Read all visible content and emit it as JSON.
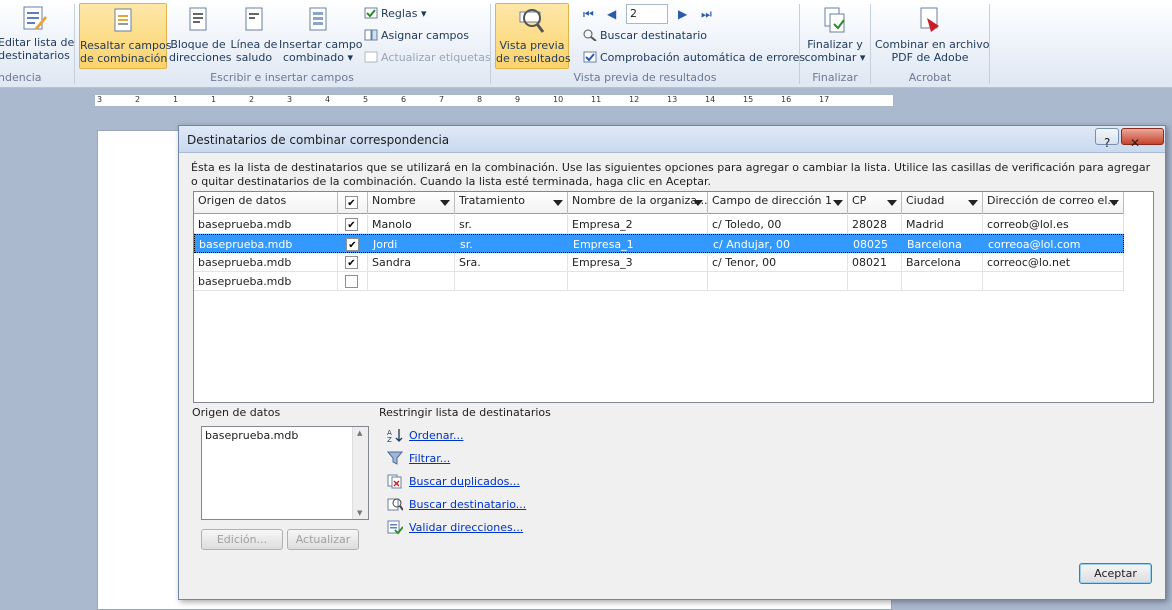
{
  "ribbon": {
    "edit_list": "Editar lista de destinatarios",
    "edit_list_l1": "Editar lista de",
    "edit_list_l2": "destinatarios",
    "group_partial": "ndencia",
    "highlight_l1": "Resaltar campos",
    "highlight_l2": "de combinación",
    "address_block_l1": "Bloque de",
    "address_block_l2": "direcciones",
    "greeting_l1": "Línea de",
    "greeting_l2": "saludo",
    "insert_field_l1": "Insertar campo",
    "insert_field_l2": "combinado",
    "rules": "Reglas",
    "match_fields": "Asignar campos",
    "update_labels": "Actualizar etiquetas",
    "group_write": "Escribir e insertar campos",
    "preview_l1": "Vista previa",
    "preview_l2": "de resultados",
    "record_number": "2",
    "find_recipient": "Buscar destinatario",
    "auto_check": "Comprobación automática de errores",
    "group_preview": "Vista previa de resultados",
    "finish_l1": "Finalizar y",
    "finish_l2": "combinar",
    "group_finish": "Finalizar",
    "pdf_l1": "Combinar en archivo",
    "pdf_l2": "PDF de Adobe",
    "group_acrobat": "Acrobat"
  },
  "ruler": {
    "ticks": [
      "3",
      "2",
      "1",
      "1",
      "2",
      "3",
      "4",
      "5",
      "6",
      "7",
      "8",
      "9",
      "10",
      "11",
      "12",
      "13",
      "14",
      "15",
      "16",
      "17"
    ]
  },
  "dialog": {
    "title": "Destinatarios de combinar correspondencia",
    "help": "?",
    "close": "✕",
    "intro": "Ésta es la lista de destinatarios que se utilizará en la combinación. Use las siguientes opciones para agregar o cambiar la lista. Utilice las casillas de verificación para agregar o quitar destinatarios de la combinación. Cuando la lista esté terminada, haga clic en Aceptar.",
    "columns": [
      "Origen de datos",
      "",
      "Nombre",
      "Tratamiento",
      "Nombre de la organiza...",
      "Campo de dirección 1",
      "CP",
      "Ciudad",
      "Dirección de correo el..."
    ],
    "rows": [
      {
        "source": "baseprueba.mdb",
        "checked": true,
        "nombre": "Manolo",
        "trat": "sr.",
        "org": "Empresa_2",
        "dir": "c/ Toledo, 00",
        "cp": "28028",
        "ciudad": "Madrid",
        "email": "correob@lol.es"
      },
      {
        "source": "baseprueba.mdb",
        "checked": true,
        "nombre": "Jordi",
        "trat": "sr.",
        "org": "Empresa_1",
        "dir": "c/ Andujar, 00",
        "cp": "08025",
        "ciudad": "Barcelona",
        "email": "correoa@lol.com"
      },
      {
        "source": "baseprueba.mdb",
        "checked": true,
        "nombre": "Sandra",
        "trat": "Sra.",
        "org": "Empresa_3",
        "dir": "c/ Tenor, 00",
        "cp": "08021",
        "ciudad": "Barcelona",
        "email": "correoc@lo.net"
      },
      {
        "source": "baseprueba.mdb",
        "checked": false,
        "nombre": "",
        "trat": "",
        "org": "",
        "dir": "",
        "cp": "",
        "ciudad": "",
        "email": ""
      }
    ],
    "datasource_label": "Origen de datos",
    "datasource_item": "baseprueba.mdb",
    "restrict_label": "Restringir lista de destinatarios",
    "sort": "Ordenar...",
    "filter": "Filtrar...",
    "dupes": "Buscar duplicados...",
    "find": "Buscar destinatario...",
    "validate": "Validar direcciones...",
    "edit_btn": "Edición...",
    "refresh_btn": "Actualizar",
    "ok_btn": "Aceptar"
  }
}
